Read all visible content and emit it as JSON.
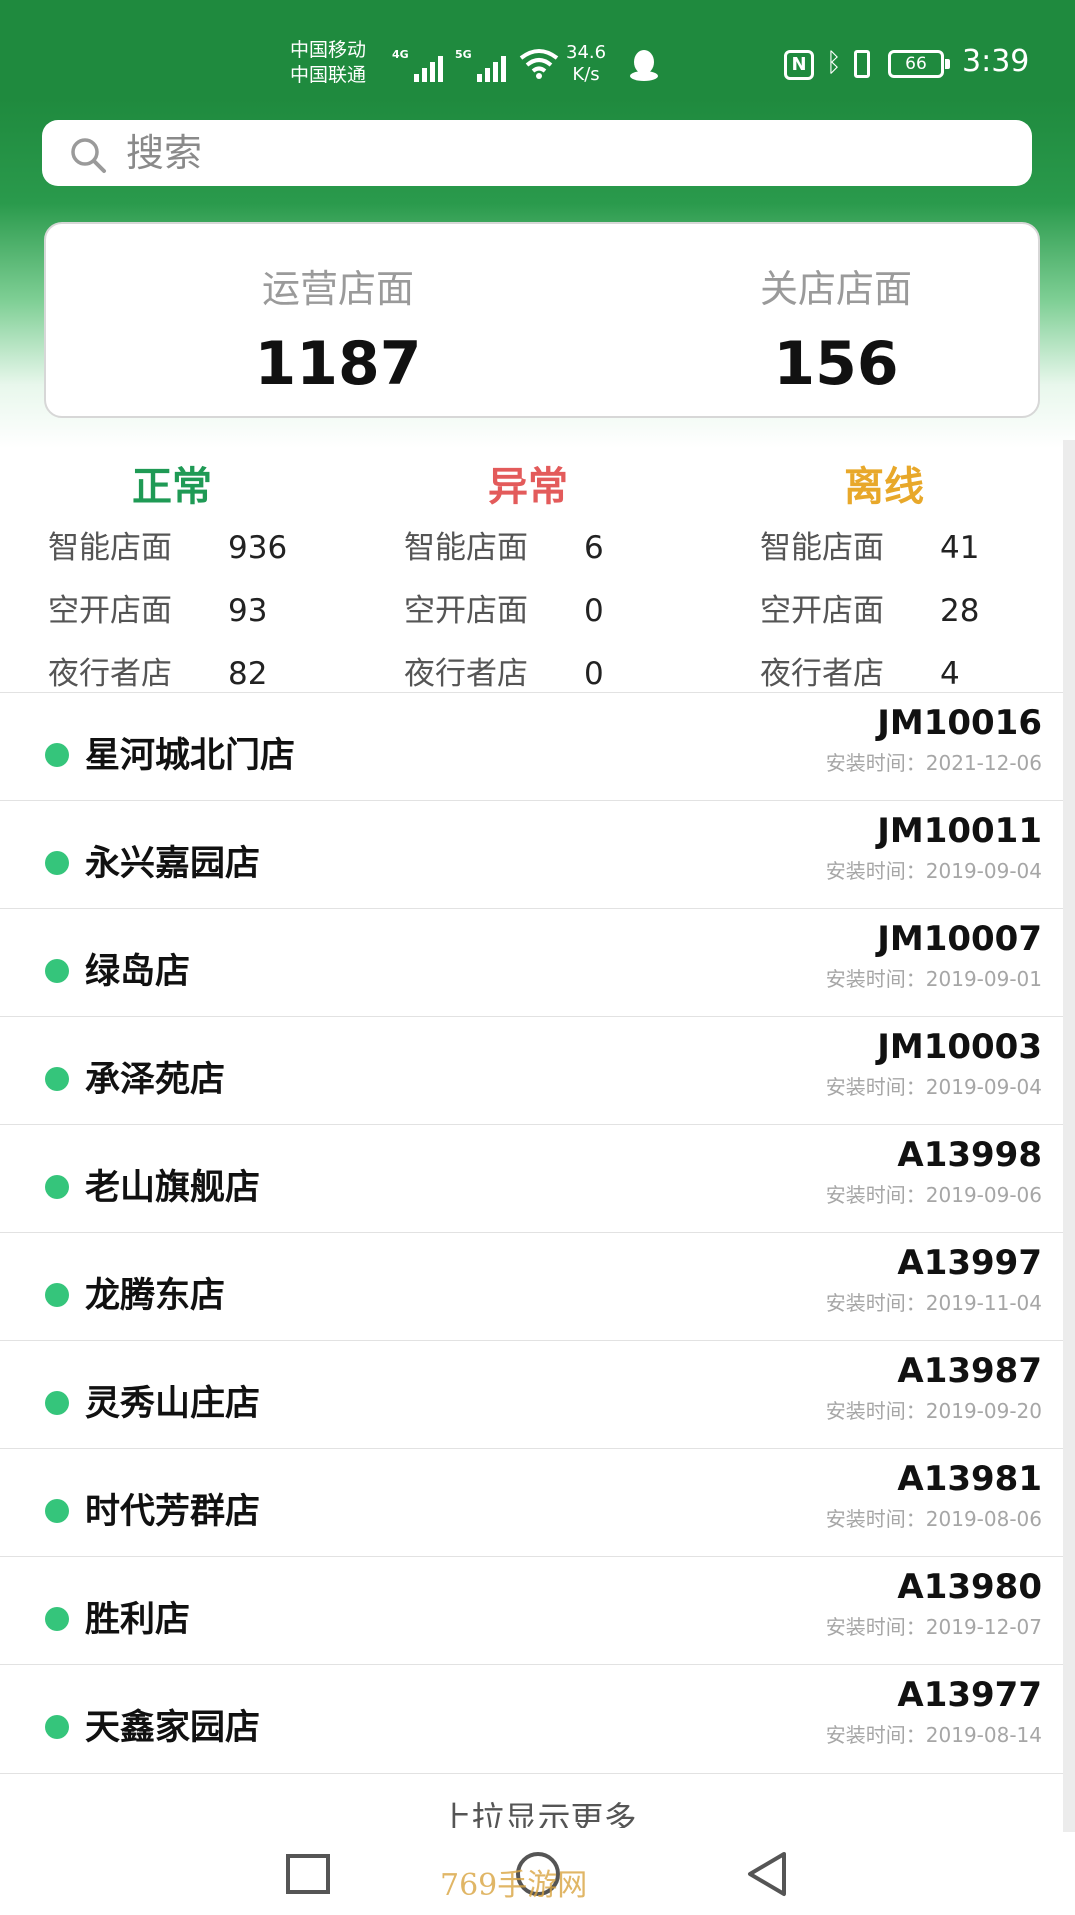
{
  "status_bar": {
    "carrier1": "中国移动",
    "carrier2": "中国联通",
    "sim1_network": "4G",
    "sim2_network": "5G",
    "speed_value": "34.6",
    "speed_unit": "K/s",
    "battery": "66",
    "time": "3:39"
  },
  "search": {
    "placeholder": "搜索"
  },
  "summary": {
    "operating_label": "运营店面",
    "operating_value": "1187",
    "closed_label": "关店店面",
    "closed_value": "156"
  },
  "status_groups": [
    {
      "title": "正常",
      "color": "#1f9a55",
      "rows": [
        {
          "label": "智能店面",
          "value": "936"
        },
        {
          "label": "空开店面",
          "value": "93"
        },
        {
          "label": "夜行者店",
          "value": "82"
        }
      ]
    },
    {
      "title": "异常",
      "color": "#e35b5b",
      "rows": [
        {
          "label": "智能店面",
          "value": "6"
        },
        {
          "label": "空开店面",
          "value": "0"
        },
        {
          "label": "夜行者店",
          "value": "0"
        }
      ]
    },
    {
      "title": "离线",
      "color": "#e8a82a",
      "rows": [
        {
          "label": "智能店面",
          "value": "41"
        },
        {
          "label": "空开店面",
          "value": "28"
        },
        {
          "label": "夜行者店",
          "value": "4"
        }
      ]
    }
  ],
  "stores": [
    {
      "name": "星河城北门店",
      "code": "JM10016",
      "install": "安装时间：2021-12-06"
    },
    {
      "name": "永兴嘉园店",
      "code": "JM10011",
      "install": "安装时间：2019-09-04"
    },
    {
      "name": "绿岛店",
      "code": "JM10007",
      "install": "安装时间：2019-09-01"
    },
    {
      "name": "承泽苑店",
      "code": "JM10003",
      "install": "安装时间：2019-09-04"
    },
    {
      "name": "老山旗舰店",
      "code": "A13998",
      "install": "安装时间：2019-09-06"
    },
    {
      "name": "龙腾东店",
      "code": "A13997",
      "install": "安装时间：2019-11-04"
    },
    {
      "name": "灵秀山庄店",
      "code": "A13987",
      "install": "安装时间：2019-09-20"
    },
    {
      "name": "时代芳群店",
      "code": "A13981",
      "install": "安装时间：2019-08-06"
    },
    {
      "name": "胜利店",
      "code": "A13980",
      "install": "安装时间：2019-12-07"
    },
    {
      "name": "天鑫家园店",
      "code": "A13977",
      "install": "安装时间：2019-08-14"
    }
  ],
  "load_more": "上拉显示更多",
  "watermark": "769手游网",
  "colors": {
    "brand_green": "#1f8a3e",
    "status_dot": "#35c57b"
  }
}
